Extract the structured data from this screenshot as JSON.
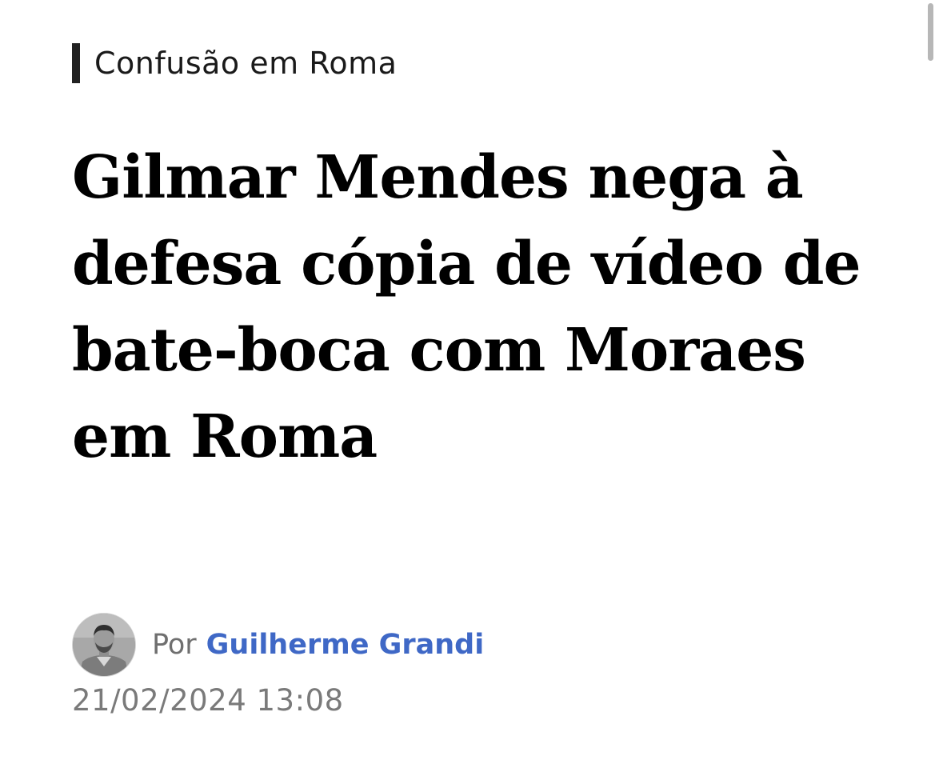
{
  "article": {
    "kicker": "Confusão em Roma",
    "headline": "Gilmar Mendes nega à defesa cópia de vídeo de bate-boca com Moraes em Roma",
    "byline_prefix": "Por",
    "author": "Guilherme Grandi",
    "timestamp": "21/02/2024 13:08"
  },
  "colors": {
    "author_link": "#3f68c6",
    "kicker_bar": "#222222",
    "meta_text": "#7a7a7a"
  }
}
